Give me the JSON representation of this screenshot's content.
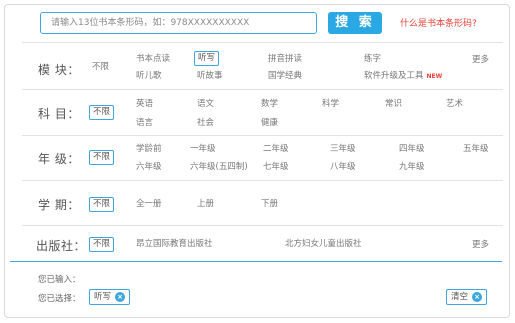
{
  "search": {
    "placeholder": "请输入13位书本条形码，如：978XXXXXXXXXX",
    "button_label": "搜 索",
    "help_link": "什么是书本条形码?"
  },
  "module": {
    "label": "模 块：",
    "unlimited": "不限",
    "options": [
      "书本点读",
      "听写",
      "拼音拼读",
      "练字",
      "听儿歌",
      "听故事",
      "国学经典",
      "软件升级及工具"
    ],
    "selected": "听写",
    "new_badge": "NEW",
    "more": "更多"
  },
  "subject": {
    "label": "科 目：",
    "unlimited": "不限",
    "options": [
      "英语",
      "语文",
      "数学",
      "科学",
      "常识",
      "艺术",
      "语言",
      "社会",
      "健康"
    ]
  },
  "grade": {
    "label": "年 级：",
    "unlimited": "不限",
    "options": [
      "学龄前",
      "一年级",
      "二年级",
      "三年级",
      "四年级",
      "五年级",
      "六年级",
      "六年级(五四制)",
      "七年级",
      "八年级",
      "九年级"
    ]
  },
  "term": {
    "label": "学 期：",
    "unlimited": "不限",
    "options": [
      "全一册",
      "上册",
      "下册"
    ]
  },
  "publisher": {
    "label": "出版社：",
    "unlimited": "不限",
    "options": [
      "昂立国际教育出版社",
      "北方妇女儿童出版社"
    ],
    "more": "更多"
  },
  "footer": {
    "entered_label": "您已输入：",
    "selected_label": "您已选择：",
    "selected_chip": "听写",
    "clear_label": "清空"
  },
  "colors": {
    "accent": "#2aa8e3",
    "link_red": "#e8413a"
  }
}
